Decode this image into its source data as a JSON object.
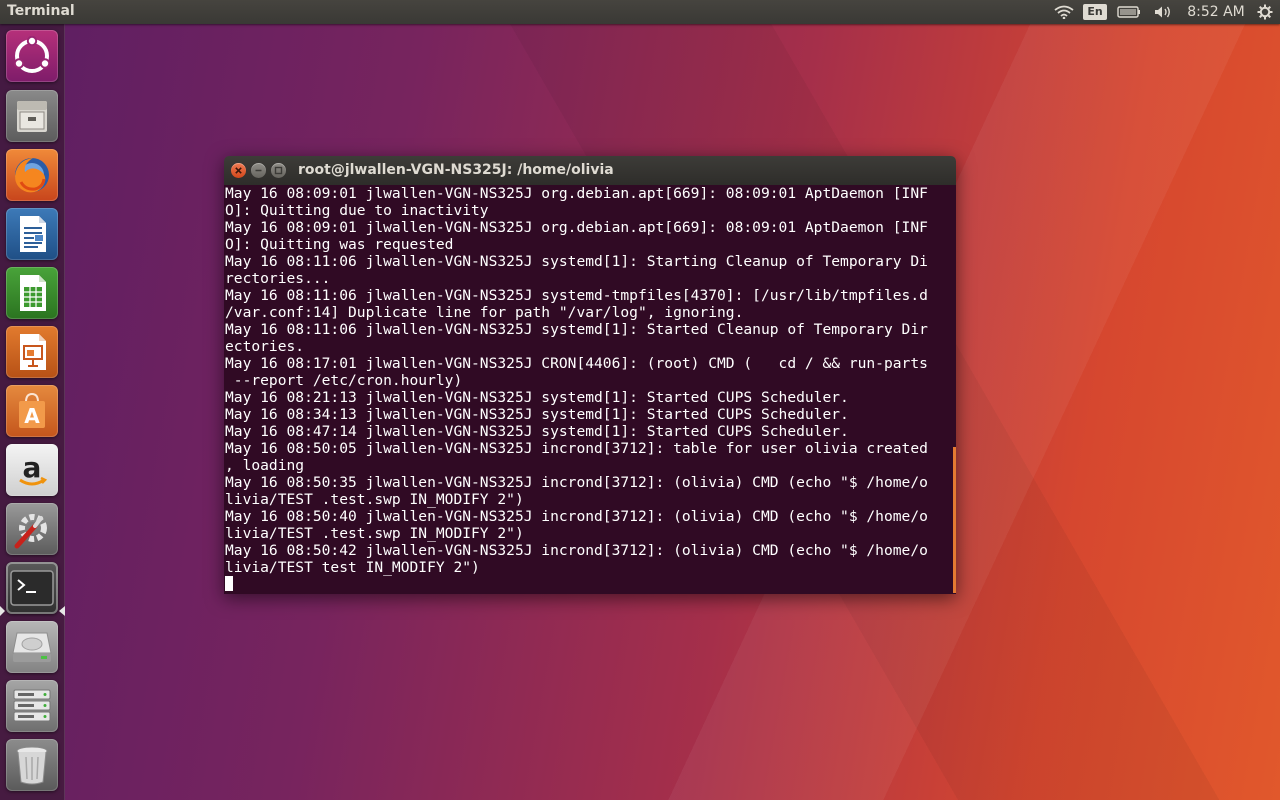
{
  "top_panel": {
    "active_app": "Terminal",
    "keyboard_layout": "En",
    "clock": "8:52 AM",
    "indicators": [
      "wifi-icon",
      "keyboard-layout-badge",
      "battery-icon",
      "volume-icon",
      "clock",
      "system-gear-icon"
    ]
  },
  "launcher": {
    "items": [
      {
        "name": "dash-home",
        "icon": "ubuntu-logo-icon"
      },
      {
        "name": "files",
        "icon": "file-cabinet-icon"
      },
      {
        "name": "firefox",
        "icon": "firefox-icon"
      },
      {
        "name": "libreoffice-writer",
        "icon": "writer-document-icon"
      },
      {
        "name": "libreoffice-calc",
        "icon": "calc-spreadsheet-icon"
      },
      {
        "name": "libreoffice-impress",
        "icon": "impress-presentation-icon"
      },
      {
        "name": "ubuntu-software",
        "icon": "shopping-bag-icon"
      },
      {
        "name": "amazon",
        "icon": "amazon-icon"
      },
      {
        "name": "system-settings",
        "icon": "settings-wrench-icon"
      },
      {
        "name": "terminal",
        "icon": "terminal-icon",
        "active": true
      },
      {
        "name": "disk-drive",
        "icon": "hard-drive-icon"
      },
      {
        "name": "network-servers",
        "icon": "server-rack-icon"
      },
      {
        "name": "trash",
        "icon": "trash-icon"
      }
    ]
  },
  "terminal": {
    "title": "root@jlwallen-VGN-NS325J: /home/olivia",
    "lines": [
      "May 16 08:09:01 jlwallen-VGN-NS325J org.debian.apt[669]: 08:09:01 AptDaemon [INF",
      "O]: Quitting due to inactivity",
      "May 16 08:09:01 jlwallen-VGN-NS325J org.debian.apt[669]: 08:09:01 AptDaemon [INF",
      "O]: Quitting was requested",
      "May 16 08:11:06 jlwallen-VGN-NS325J systemd[1]: Starting Cleanup of Temporary Di",
      "rectories...",
      "May 16 08:11:06 jlwallen-VGN-NS325J systemd-tmpfiles[4370]: [/usr/lib/tmpfiles.d",
      "/var.conf:14] Duplicate line for path \"/var/log\", ignoring.",
      "May 16 08:11:06 jlwallen-VGN-NS325J systemd[1]: Started Cleanup of Temporary Dir",
      "ectories.",
      "May 16 08:17:01 jlwallen-VGN-NS325J CRON[4406]: (root) CMD (   cd / && run-parts",
      " --report /etc/cron.hourly)",
      "May 16 08:21:13 jlwallen-VGN-NS325J systemd[1]: Started CUPS Scheduler.",
      "May 16 08:34:13 jlwallen-VGN-NS325J systemd[1]: Started CUPS Scheduler.",
      "May 16 08:47:14 jlwallen-VGN-NS325J systemd[1]: Started CUPS Scheduler.",
      "May 16 08:50:05 jlwallen-VGN-NS325J incrond[3712]: table for user olivia created",
      ", loading",
      "May 16 08:50:35 jlwallen-VGN-NS325J incrond[3712]: (olivia) CMD (echo \"$ /home/o",
      "livia/TEST .test.swp IN_MODIFY 2\")",
      "May 16 08:50:40 jlwallen-VGN-NS325J incrond[3712]: (olivia) CMD (echo \"$ /home/o",
      "livia/TEST .test.swp IN_MODIFY 2\")",
      "May 16 08:50:42 jlwallen-VGN-NS325J incrond[3712]: (olivia) CMD (echo \"$ /home/o",
      "livia/TEST test IN_MODIFY 2\")"
    ]
  },
  "colors": {
    "terminal_background": "#300a24",
    "terminal_text": "#ffffff",
    "close_button": "#e0542a",
    "panel": "#3c3b37",
    "accent": "#e37a32"
  }
}
